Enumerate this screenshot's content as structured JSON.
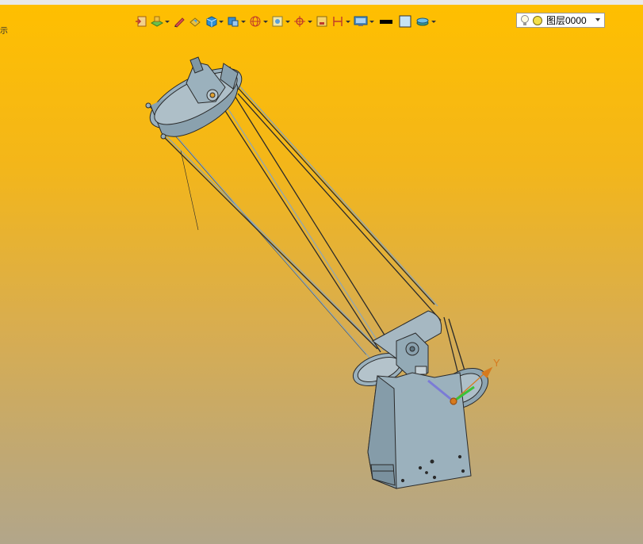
{
  "viewport": {
    "corner_text": "示",
    "background_top": "#ffbf00",
    "background_bottom": "#b2a68a"
  },
  "toolbar": {
    "items": [
      {
        "icon": "exit-sketch-icon",
        "has_dropdown": false
      },
      {
        "icon": "layer-sheet-icon",
        "has_dropdown": true
      },
      {
        "icon": "pencil-icon",
        "has_dropdown": false
      },
      {
        "icon": "paint-bucket-icon",
        "has_dropdown": false
      },
      {
        "icon": "solid-cube-icon",
        "has_dropdown": true
      },
      {
        "icon": "view-orient-icon",
        "has_dropdown": true
      },
      {
        "icon": "wireframe-sphere-icon",
        "has_dropdown": true
      },
      {
        "icon": "view-box-icon",
        "has_dropdown": true
      },
      {
        "icon": "snap-crosshair-icon",
        "has_dropdown": true
      },
      {
        "icon": "yellow-frame-icon",
        "has_dropdown": false
      },
      {
        "icon": "dimension-bracket-icon",
        "has_dropdown": true
      },
      {
        "icon": "display-monitor-icon",
        "has_dropdown": true
      },
      {
        "icon": "line-color-icon",
        "has_dropdown": false
      },
      {
        "icon": "fill-color-icon",
        "has_dropdown": false
      },
      {
        "icon": "layer-stack-icon",
        "has_dropdown": true
      }
    ],
    "layer_selector": {
      "value": "图层0000",
      "bulb_icon": "lightbulb-icon",
      "status_icon": "layer-on-icon"
    }
  },
  "model": {
    "name": "dobsonian-telescope",
    "body_color": "#9bb1bd",
    "edge_color": "#2a2a2a",
    "triad_label": "Y",
    "triad_color": "#d67a1e"
  }
}
